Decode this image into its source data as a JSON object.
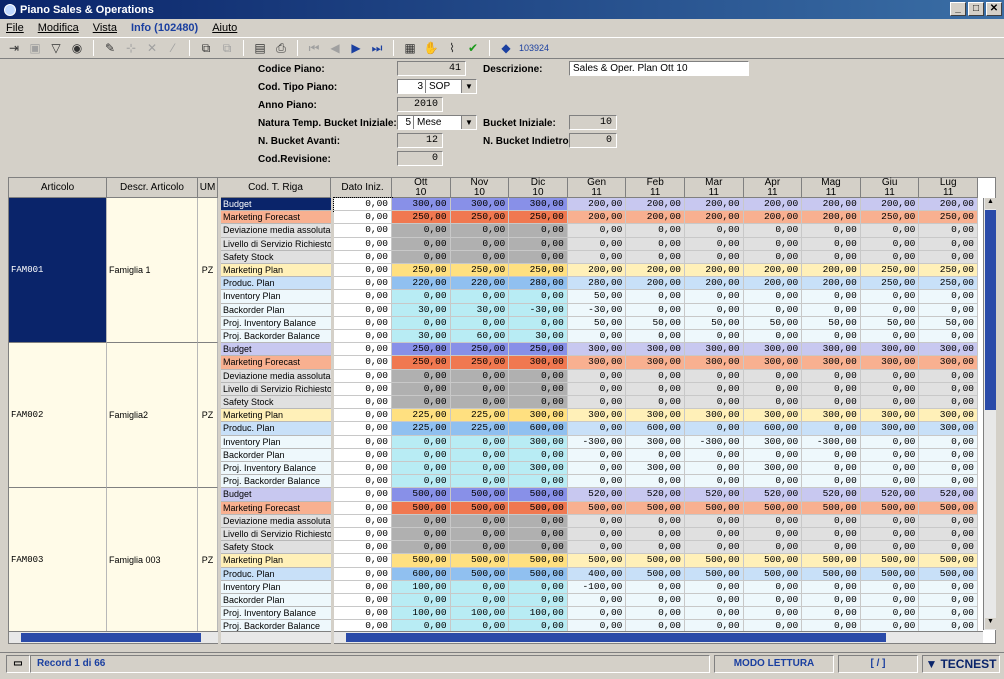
{
  "window": {
    "title": "Piano Sales & Operations"
  },
  "menu": {
    "file": "File",
    "modifica": "Modifica",
    "vista": "Vista",
    "info": "Info (102480)",
    "aiuto": "Aiuto"
  },
  "toolbar": {
    "record_id": "103924"
  },
  "form": {
    "codice_piano_label": "Codice Piano:",
    "codice_piano": "41",
    "descrizione_label": "Descrizione:",
    "descrizione": "Sales & Oper. Plan Ott 10",
    "cod_tipo_label": "Cod. Tipo Piano:",
    "cod_tipo_num": "3",
    "cod_tipo_txt": "SOP",
    "anno_label": "Anno Piano:",
    "anno": "2010",
    "natura_label": "Natura Temp. Bucket Iniziale:",
    "natura_num": "5",
    "natura_txt": "Mese",
    "bucket_iniziale_label": "Bucket Iniziale:",
    "bucket_iniziale": "10",
    "avanti_label": "N. Bucket Avanti:",
    "avanti": "12",
    "indietro_label": "N. Bucket Indietro:",
    "indietro": "0",
    "revisione_label": "Cod.Revisione:",
    "revisione": "0"
  },
  "grid": {
    "headers": {
      "articolo": "Articolo",
      "descr": "Descr. Articolo",
      "um": "UM",
      "cod_riga": "Cod. T. Riga",
      "dato": "Dato Iniz."
    },
    "periods": [
      [
        "Ott",
        "10"
      ],
      [
        "Nov",
        "10"
      ],
      [
        "Dic",
        "10"
      ],
      [
        "Gen",
        "11"
      ],
      [
        "Feb",
        "11"
      ],
      [
        "Mar",
        "11"
      ],
      [
        "Apr",
        "11"
      ],
      [
        "Mag",
        "11"
      ],
      [
        "Giu",
        "11"
      ],
      [
        "Lug",
        "11"
      ]
    ],
    "row_types": [
      "Budget",
      "Marketing Forecast",
      "Deviazione media assoluta",
      "Livello di Servizio Richiesto",
      "Safety Stock",
      "Marketing Plan",
      "Produc. Plan",
      "Inventory Plan",
      "Backorder Plan",
      "Proj. Inventory Balance",
      "Proj. Backorder Balance"
    ],
    "families": [
      {
        "code": "FAM001",
        "descr": "Famiglia 1",
        "um": "PZ",
        "rows": [
          [
            "0,00",
            "300,00",
            "300,00",
            "300,00",
            "200,00",
            "200,00",
            "200,00",
            "200,00",
            "200,00",
            "200,00",
            "200,00"
          ],
          [
            "0,00",
            "250,00",
            "250,00",
            "250,00",
            "200,00",
            "200,00",
            "200,00",
            "200,00",
            "200,00",
            "250,00",
            "250,00"
          ],
          [
            "0,00",
            "0,00",
            "0,00",
            "0,00",
            "0,00",
            "0,00",
            "0,00",
            "0,00",
            "0,00",
            "0,00",
            "0,00"
          ],
          [
            "0,00",
            "0,00",
            "0,00",
            "0,00",
            "0,00",
            "0,00",
            "0,00",
            "0,00",
            "0,00",
            "0,00",
            "0,00"
          ],
          [
            "0,00",
            "0,00",
            "0,00",
            "0,00",
            "0,00",
            "0,00",
            "0,00",
            "0,00",
            "0,00",
            "0,00",
            "0,00"
          ],
          [
            "0,00",
            "250,00",
            "250,00",
            "250,00",
            "200,00",
            "200,00",
            "200,00",
            "200,00",
            "200,00",
            "250,00",
            "250,00"
          ],
          [
            "0,00",
            "220,00",
            "220,00",
            "280,00",
            "280,00",
            "200,00",
            "200,00",
            "200,00",
            "200,00",
            "250,00",
            "250,00"
          ],
          [
            "0,00",
            "0,00",
            "0,00",
            "0,00",
            "50,00",
            "0,00",
            "0,00",
            "0,00",
            "0,00",
            "0,00",
            "0,00"
          ],
          [
            "0,00",
            "30,00",
            "30,00",
            "-30,00",
            "-30,00",
            "0,00",
            "0,00",
            "0,00",
            "0,00",
            "0,00",
            "0,00"
          ],
          [
            "0,00",
            "0,00",
            "0,00",
            "0,00",
            "50,00",
            "50,00",
            "50,00",
            "50,00",
            "50,00",
            "50,00",
            "50,00"
          ],
          [
            "0,00",
            "30,00",
            "60,00",
            "30,00",
            "0,00",
            "0,00",
            "0,00",
            "0,00",
            "0,00",
            "0,00",
            "0,00"
          ]
        ]
      },
      {
        "code": "FAM002",
        "descr": "Famiglia2",
        "um": "PZ",
        "rows": [
          [
            "0,00",
            "250,00",
            "250,00",
            "250,00",
            "300,00",
            "300,00",
            "300,00",
            "300,00",
            "300,00",
            "300,00",
            "300,00"
          ],
          [
            "0,00",
            "250,00",
            "250,00",
            "300,00",
            "300,00",
            "300,00",
            "300,00",
            "300,00",
            "300,00",
            "300,00",
            "300,00"
          ],
          [
            "0,00",
            "0,00",
            "0,00",
            "0,00",
            "0,00",
            "0,00",
            "0,00",
            "0,00",
            "0,00",
            "0,00",
            "0,00"
          ],
          [
            "0,00",
            "0,00",
            "0,00",
            "0,00",
            "0,00",
            "0,00",
            "0,00",
            "0,00",
            "0,00",
            "0,00",
            "0,00"
          ],
          [
            "0,00",
            "0,00",
            "0,00",
            "0,00",
            "0,00",
            "0,00",
            "0,00",
            "0,00",
            "0,00",
            "0,00",
            "0,00"
          ],
          [
            "0,00",
            "225,00",
            "225,00",
            "300,00",
            "300,00",
            "300,00",
            "300,00",
            "300,00",
            "300,00",
            "300,00",
            "300,00"
          ],
          [
            "0,00",
            "225,00",
            "225,00",
            "600,00",
            "0,00",
            "600,00",
            "0,00",
            "600,00",
            "0,00",
            "300,00",
            "300,00"
          ],
          [
            "0,00",
            "0,00",
            "0,00",
            "300,00",
            "-300,00",
            "300,00",
            "-300,00",
            "300,00",
            "-300,00",
            "0,00",
            "0,00"
          ],
          [
            "0,00",
            "0,00",
            "0,00",
            "0,00",
            "0,00",
            "0,00",
            "0,00",
            "0,00",
            "0,00",
            "0,00",
            "0,00"
          ],
          [
            "0,00",
            "0,00",
            "0,00",
            "300,00",
            "0,00",
            "300,00",
            "0,00",
            "300,00",
            "0,00",
            "0,00",
            "0,00"
          ],
          [
            "0,00",
            "0,00",
            "0,00",
            "0,00",
            "0,00",
            "0,00",
            "0,00",
            "0,00",
            "0,00",
            "0,00",
            "0,00"
          ]
        ]
      },
      {
        "code": "FAM003",
        "descr": "Famiglia 003",
        "um": "PZ",
        "rows": [
          [
            "0,00",
            "500,00",
            "500,00",
            "500,00",
            "520,00",
            "520,00",
            "520,00",
            "520,00",
            "520,00",
            "520,00",
            "520,00"
          ],
          [
            "0,00",
            "500,00",
            "500,00",
            "500,00",
            "500,00",
            "500,00",
            "500,00",
            "500,00",
            "500,00",
            "500,00",
            "500,00"
          ],
          [
            "0,00",
            "0,00",
            "0,00",
            "0,00",
            "0,00",
            "0,00",
            "0,00",
            "0,00",
            "0,00",
            "0,00",
            "0,00"
          ],
          [
            "0,00",
            "0,00",
            "0,00",
            "0,00",
            "0,00",
            "0,00",
            "0,00",
            "0,00",
            "0,00",
            "0,00",
            "0,00"
          ],
          [
            "0,00",
            "0,00",
            "0,00",
            "0,00",
            "0,00",
            "0,00",
            "0,00",
            "0,00",
            "0,00",
            "0,00",
            "0,00"
          ],
          [
            "0,00",
            "500,00",
            "500,00",
            "500,00",
            "500,00",
            "500,00",
            "500,00",
            "500,00",
            "500,00",
            "500,00",
            "500,00"
          ],
          [
            "0,00",
            "600,00",
            "500,00",
            "500,00",
            "400,00",
            "500,00",
            "500,00",
            "500,00",
            "500,00",
            "500,00",
            "500,00"
          ],
          [
            "0,00",
            "100,00",
            "0,00",
            "0,00",
            "-100,00",
            "0,00",
            "0,00",
            "0,00",
            "0,00",
            "0,00",
            "0,00"
          ],
          [
            "0,00",
            "0,00",
            "0,00",
            "0,00",
            "0,00",
            "0,00",
            "0,00",
            "0,00",
            "0,00",
            "0,00",
            "0,00"
          ],
          [
            "0,00",
            "100,00",
            "100,00",
            "100,00",
            "0,00",
            "0,00",
            "0,00",
            "0,00",
            "0,00",
            "0,00",
            "0,00"
          ],
          [
            "0,00",
            "0,00",
            "0,00",
            "0,00",
            "0,00",
            "0,00",
            "0,00",
            "0,00",
            "0,00",
            "0,00",
            "0,00"
          ]
        ]
      }
    ]
  },
  "status": {
    "record": "Record 1 di 66",
    "mode": "MODO LETTURA",
    "brackets": "[ / ]",
    "brand": "TECNEST"
  },
  "colors": {
    "selection": "#0a246a",
    "budget": "#c8c8f0",
    "forecast": "#f8b090",
    "mplan": "#fff0b8",
    "prod": "#c8e0f8",
    "cyan": "#d8f4f8"
  }
}
